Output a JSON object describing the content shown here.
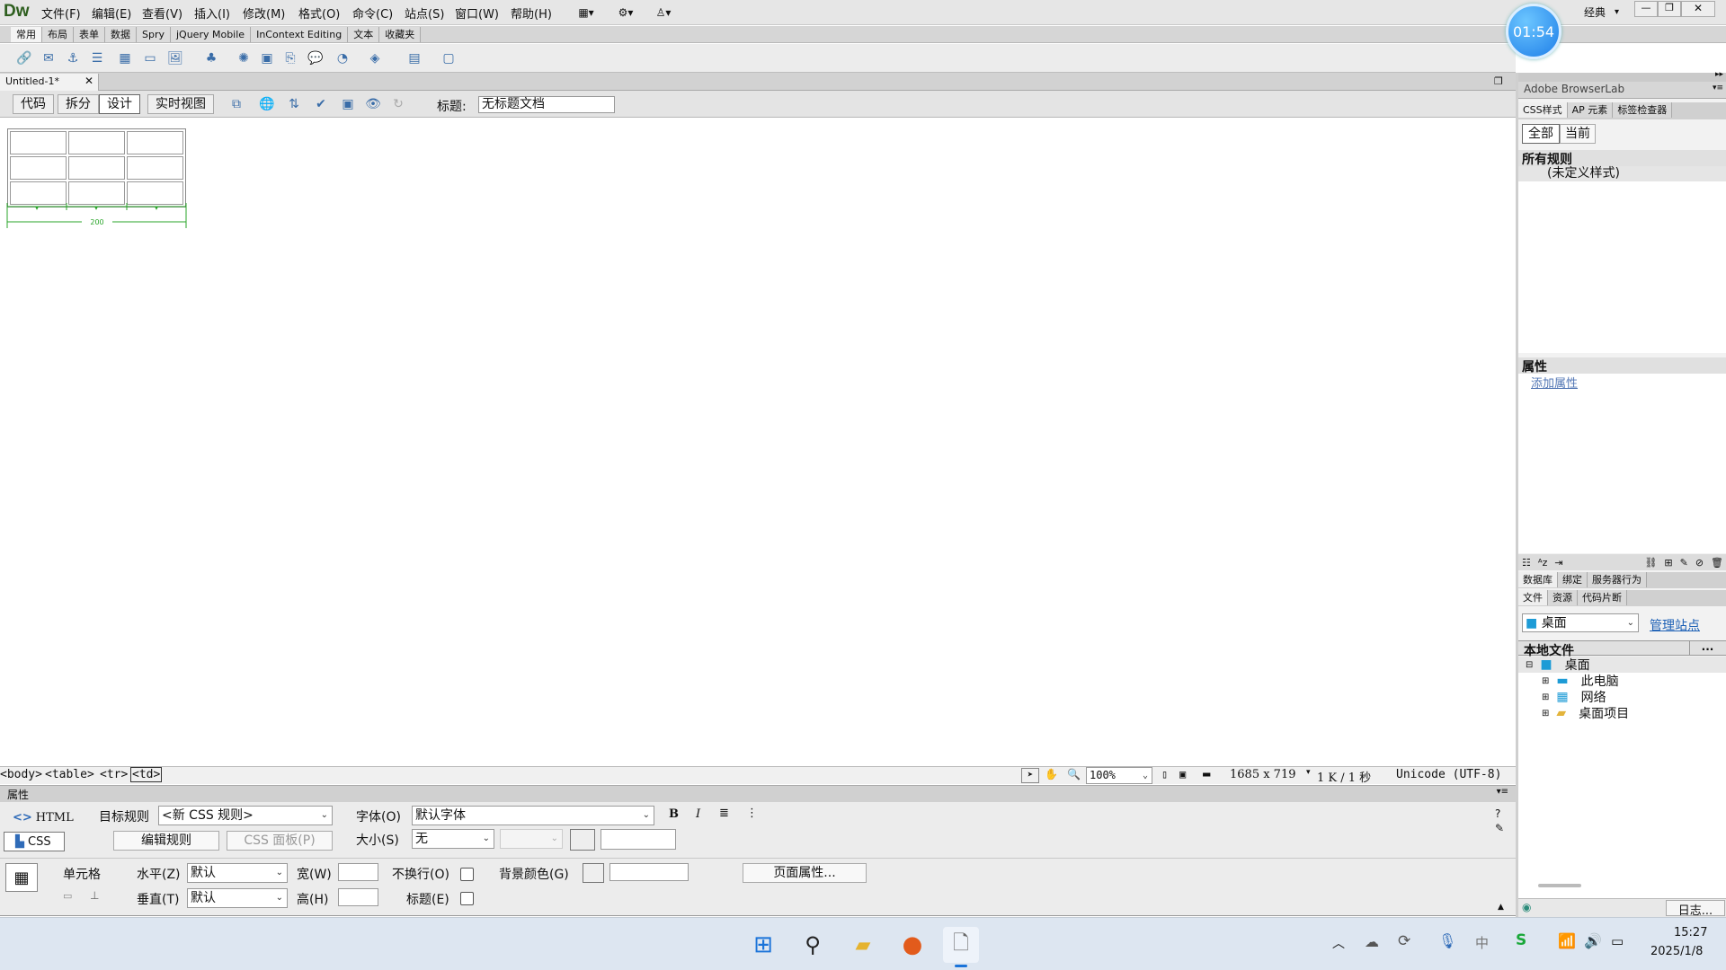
{
  "app": {
    "logo": "Dw",
    "menu": [
      "文件(F)",
      "编辑(E)",
      "查看(V)",
      "插入(I)",
      "修改(M)",
      "格式(O)",
      "命令(C)",
      "站点(S)",
      "窗口(W)",
      "帮助(H)"
    ],
    "workspace": "经典",
    "clock": "01:54"
  },
  "insert_tabs": [
    "常用",
    "布局",
    "表单",
    "数据",
    "Spry",
    "jQuery Mobile",
    "InContext Editing",
    "文本",
    "收藏夹"
  ],
  "insert_icons": [
    "hyperlink-icon",
    "email-link-icon",
    "named-anchor-icon",
    "horizontal-rule-icon",
    "table-icon",
    "insert-div-icon",
    "images-icon",
    "media-icon",
    "date-icon",
    "server-include-icon",
    "comment-icon",
    "head-icon",
    "script-icon",
    "templates-icon",
    "tag-chooser-icon"
  ],
  "document": {
    "tab_title": "Untitled-1*",
    "view_buttons": [
      "代码",
      "拆分",
      "设计",
      "实时视图"
    ],
    "title_label": "标题:",
    "title_value": "无标题文档",
    "table_width_label": "200"
  },
  "status": {
    "tags": [
      "<body>",
      "<table>",
      "<tr>",
      "<td>"
    ],
    "zoom": "100%",
    "dimensions": "1685 x 719",
    "download": "1 K / 1 秒",
    "encoding": "Unicode (UTF-8)"
  },
  "properties": {
    "header": "属性",
    "html_label": "HTML",
    "css_label": "CSS",
    "target_rule_label": "目标规则",
    "target_rule_value": "<新 CSS 规则>",
    "edit_rule_button": "编辑规则",
    "css_panel_button": "CSS 面板(P)",
    "font_label": "字体(O)",
    "font_value": "默认字体",
    "size_label": "大小(S)",
    "size_value": "无",
    "cell_label": "单元格",
    "horz_label": "水平(Z)",
    "horz_value": "默认",
    "vert_label": "垂直(T)",
    "vert_value": "默认",
    "width_label": "宽(W)",
    "height_label": "高(H)",
    "nowrap_label": "不换行(O)",
    "header_label": "标题(E)",
    "bgcolor_label": "背景颜色(G)",
    "page_props_button": "页面属性...",
    "bold": "B",
    "italic": "I"
  },
  "right_panel": {
    "browserlab": "Adobe BrowserLab",
    "css_tabs": [
      "CSS样式",
      "AP 元素",
      "标签检查器"
    ],
    "css_buttons": [
      "全部",
      "当前"
    ],
    "all_rules_header": "所有规则",
    "undefined_style": "(未定义样式)",
    "attributes_header": "属性",
    "add_attribute": "添加属性",
    "db_tabs": [
      "数据库",
      "绑定",
      "服务器行为"
    ],
    "file_tabs": [
      "文件",
      "资源",
      "代码片断"
    ],
    "site_select": "桌面",
    "manage_sites": "管理站点",
    "local_files": "本地文件",
    "tree": [
      "桌面",
      "此电脑",
      "网络",
      "桌面项目"
    ],
    "log_button": "日志..."
  },
  "taskbar": {
    "time": "15:27",
    "date": "2025/1/8",
    "ime": "中"
  }
}
